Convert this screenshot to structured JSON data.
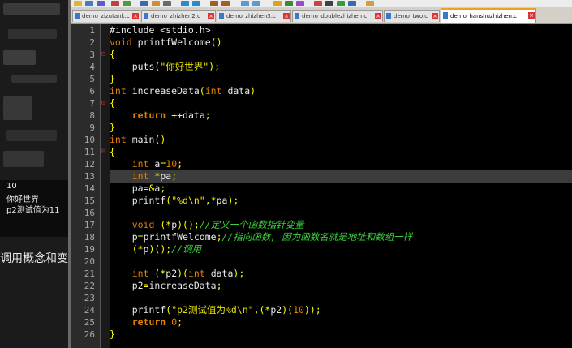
{
  "console": {
    "lines": [
      "10",
      "你好世界",
      "p2测试值为11"
    ]
  },
  "page_text": "调用概念和变",
  "tabs": [
    {
      "label": "demo_zizutank.c",
      "active": false
    },
    {
      "label": "demo_zhizhen2.c",
      "active": false
    },
    {
      "label": "demo_zhizhen3.c",
      "active": false
    },
    {
      "label": "demo_doublezhizhen.c",
      "active": false
    },
    {
      "label": "demo_two.c",
      "active": false
    },
    {
      "label": "demo_hanshuzhizhen.c",
      "active": true
    }
  ],
  "editor": {
    "current_line": 13,
    "lines": [
      {
        "n": 1,
        "t": [
          [
            "pp",
            "#include <stdio.h>"
          ]
        ]
      },
      {
        "n": 2,
        "t": [
          [
            "ty",
            "void"
          ],
          [
            "",
            " printfWelcome"
          ],
          [
            "op",
            "()"
          ]
        ]
      },
      {
        "n": 3,
        "t": [
          [
            "op",
            "{"
          ]
        ]
      },
      {
        "n": 4,
        "t": [
          [
            "",
            "    puts"
          ],
          [
            "op",
            "("
          ],
          [
            "str",
            "\"你好世界\""
          ],
          [
            "op",
            ");"
          ]
        ]
      },
      {
        "n": 5,
        "t": [
          [
            "op",
            "}"
          ]
        ]
      },
      {
        "n": 6,
        "t": [
          [
            "ty",
            "int"
          ],
          [
            "",
            " increaseData"
          ],
          [
            "op",
            "("
          ],
          [
            "ty",
            "int"
          ],
          [
            "",
            " data"
          ],
          [
            "op",
            ")"
          ]
        ]
      },
      {
        "n": 7,
        "t": [
          [
            "op",
            "{"
          ]
        ]
      },
      {
        "n": 8,
        "t": [
          [
            "kw",
            "    return"
          ],
          [
            "",
            " "
          ],
          [
            "op",
            "++"
          ],
          [
            "",
            "data"
          ],
          [
            "op",
            ";"
          ]
        ]
      },
      {
        "n": 9,
        "t": [
          [
            "op",
            "}"
          ]
        ]
      },
      {
        "n": 10,
        "t": [
          [
            "ty",
            "int"
          ],
          [
            "",
            " main"
          ],
          [
            "op",
            "()"
          ]
        ]
      },
      {
        "n": 11,
        "t": [
          [
            "op",
            "{"
          ]
        ]
      },
      {
        "n": 12,
        "t": [
          [
            "ty",
            "    int"
          ],
          [
            "",
            " a"
          ],
          [
            "op",
            "="
          ],
          [
            "num",
            "10"
          ],
          [
            "op",
            ";"
          ]
        ]
      },
      {
        "n": 13,
        "t": [
          [
            "ty",
            "    int"
          ],
          [
            "",
            " "
          ],
          [
            "op",
            "*"
          ],
          [
            "",
            "pa"
          ],
          [
            "op",
            ";"
          ]
        ]
      },
      {
        "n": 14,
        "t": [
          [
            "",
            "    pa"
          ],
          [
            "op",
            "=&"
          ],
          [
            "",
            "a"
          ],
          [
            "op",
            ";"
          ]
        ]
      },
      {
        "n": 15,
        "t": [
          [
            "",
            "    printf"
          ],
          [
            "op",
            "("
          ],
          [
            "str",
            "\"%d\\n\""
          ],
          [
            "op",
            ",*"
          ],
          [
            "",
            "pa"
          ],
          [
            "op",
            ");"
          ]
        ]
      },
      {
        "n": 16,
        "t": []
      },
      {
        "n": 17,
        "t": [
          [
            "ty",
            "    void"
          ],
          [
            "",
            " "
          ],
          [
            "op",
            "(*"
          ],
          [
            "",
            "p"
          ],
          [
            "op",
            ")();"
          ],
          [
            "cm",
            "//定义一个函数指针变量"
          ]
        ]
      },
      {
        "n": 18,
        "t": [
          [
            "",
            "    p"
          ],
          [
            "op",
            "="
          ],
          [
            "",
            "printfWelcome"
          ],
          [
            "op",
            ";"
          ],
          [
            "cm",
            "//指向函数, 因为函数名就是地址和数组一样"
          ]
        ]
      },
      {
        "n": 19,
        "t": [
          [
            "op",
            "    (*"
          ],
          [
            "",
            "p"
          ],
          [
            "op",
            ")();"
          ],
          [
            "cm",
            "//调用"
          ]
        ]
      },
      {
        "n": 20,
        "t": []
      },
      {
        "n": 21,
        "t": [
          [
            "ty",
            "    int"
          ],
          [
            "",
            " "
          ],
          [
            "op",
            "(*"
          ],
          [
            "",
            "p2"
          ],
          [
            "op",
            ")("
          ],
          [
            "ty",
            "int"
          ],
          [
            "",
            " data"
          ],
          [
            "op",
            ");"
          ]
        ]
      },
      {
        "n": 22,
        "t": [
          [
            "",
            "    p2"
          ],
          [
            "op",
            "="
          ],
          [
            "",
            "increaseData"
          ],
          [
            "op",
            ";"
          ]
        ]
      },
      {
        "n": 23,
        "t": []
      },
      {
        "n": 24,
        "t": [
          [
            "",
            "    printf"
          ],
          [
            "op",
            "("
          ],
          [
            "str",
            "\"p2测试值为%d\\n\""
          ],
          [
            "op",
            ",(*"
          ],
          [
            "",
            "p2"
          ],
          [
            "op",
            ")("
          ],
          [
            "num",
            "10"
          ],
          [
            "op",
            "));"
          ]
        ]
      },
      {
        "n": 25,
        "t": [
          [
            "kw",
            "    return"
          ],
          [
            "",
            " "
          ],
          [
            "num",
            "0"
          ],
          [
            "op",
            ";"
          ]
        ]
      },
      {
        "n": 26,
        "t": [
          [
            "op",
            "}"
          ]
        ]
      }
    ]
  },
  "colors": {
    "keyword": "#e08000",
    "operator": "#ffff00",
    "comment": "#3cd23c",
    "fold_marker": "#d03030",
    "current_line_bg": "#3c3c3c"
  }
}
